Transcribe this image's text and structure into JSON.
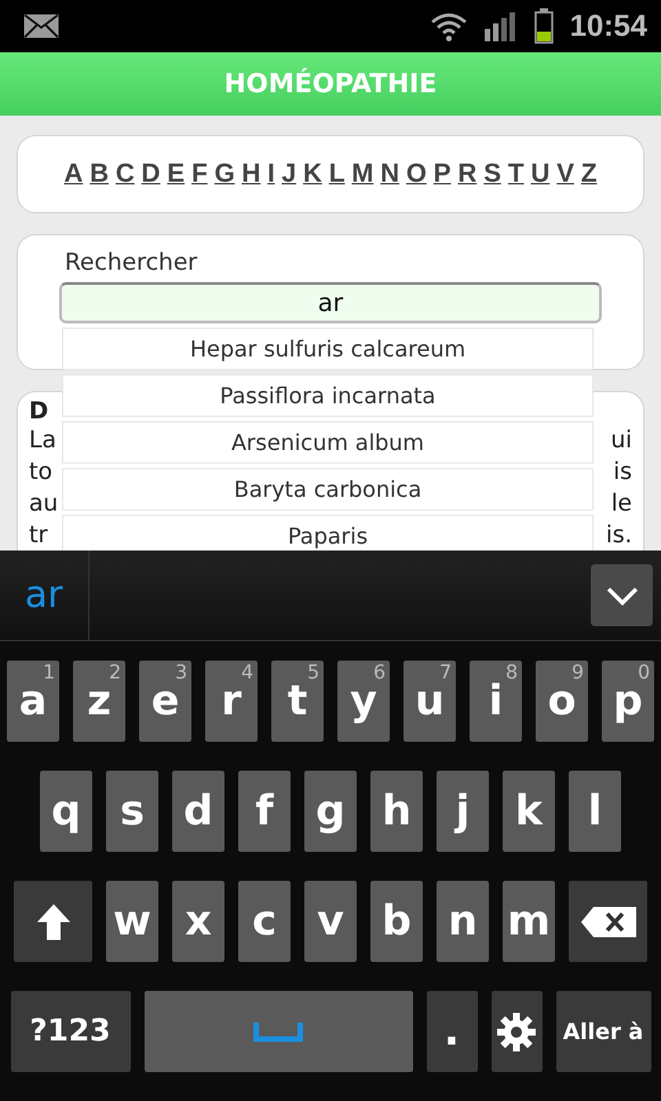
{
  "status_bar": {
    "time": "10:54"
  },
  "header": {
    "title": "HOMÉOPATHIE"
  },
  "alphabet": [
    "A",
    "B",
    "C",
    "D",
    "E",
    "F",
    "G",
    "H",
    "I",
    "J",
    "K",
    "L",
    "M",
    "N",
    "O",
    "P",
    "R",
    "S",
    "T",
    "U",
    "V",
    "Z"
  ],
  "search": {
    "label": "Rechercher",
    "value": "ar"
  },
  "suggestions": [
    "Hepar sulfuris calcareum",
    "Passiflora incarnata",
    "Arsenicum album",
    "Baryta carbonica",
    "Paparis"
  ],
  "description": {
    "heading": "D",
    "lines": [
      {
        "left": "La",
        "right": "ui"
      },
      {
        "left": "to",
        "right": "is"
      },
      {
        "left": "au",
        "right": "le"
      },
      {
        "left": "tr",
        "right": "is."
      }
    ]
  },
  "keyboard": {
    "suggestion": "ar",
    "rows": [
      [
        {
          "label": "a",
          "hint": "1"
        },
        {
          "label": "z",
          "hint": "2"
        },
        {
          "label": "e",
          "hint": "3"
        },
        {
          "label": "r",
          "hint": "4"
        },
        {
          "label": "t",
          "hint": "5"
        },
        {
          "label": "y",
          "hint": "6"
        },
        {
          "label": "u",
          "hint": "7"
        },
        {
          "label": "i",
          "hint": "8"
        },
        {
          "label": "o",
          "hint": "9"
        },
        {
          "label": "p",
          "hint": "0"
        }
      ],
      [
        {
          "label": "q"
        },
        {
          "label": "s"
        },
        {
          "label": "d"
        },
        {
          "label": "f"
        },
        {
          "label": "g"
        },
        {
          "label": "h"
        },
        {
          "label": "j"
        },
        {
          "label": "k"
        },
        {
          "label": "l"
        }
      ],
      [
        {
          "kind": "shift"
        },
        {
          "label": "w"
        },
        {
          "label": "x"
        },
        {
          "label": "c"
        },
        {
          "label": "v"
        },
        {
          "label": "b"
        },
        {
          "label": "n"
        },
        {
          "label": "m"
        },
        {
          "kind": "backspace"
        }
      ]
    ],
    "bottom_row": [
      {
        "kind": "symbols",
        "label": "?123"
      },
      {
        "kind": "space"
      },
      {
        "kind": "period",
        "label": "."
      },
      {
        "kind": "settings"
      },
      {
        "kind": "action",
        "label": "Aller à"
      }
    ]
  }
}
